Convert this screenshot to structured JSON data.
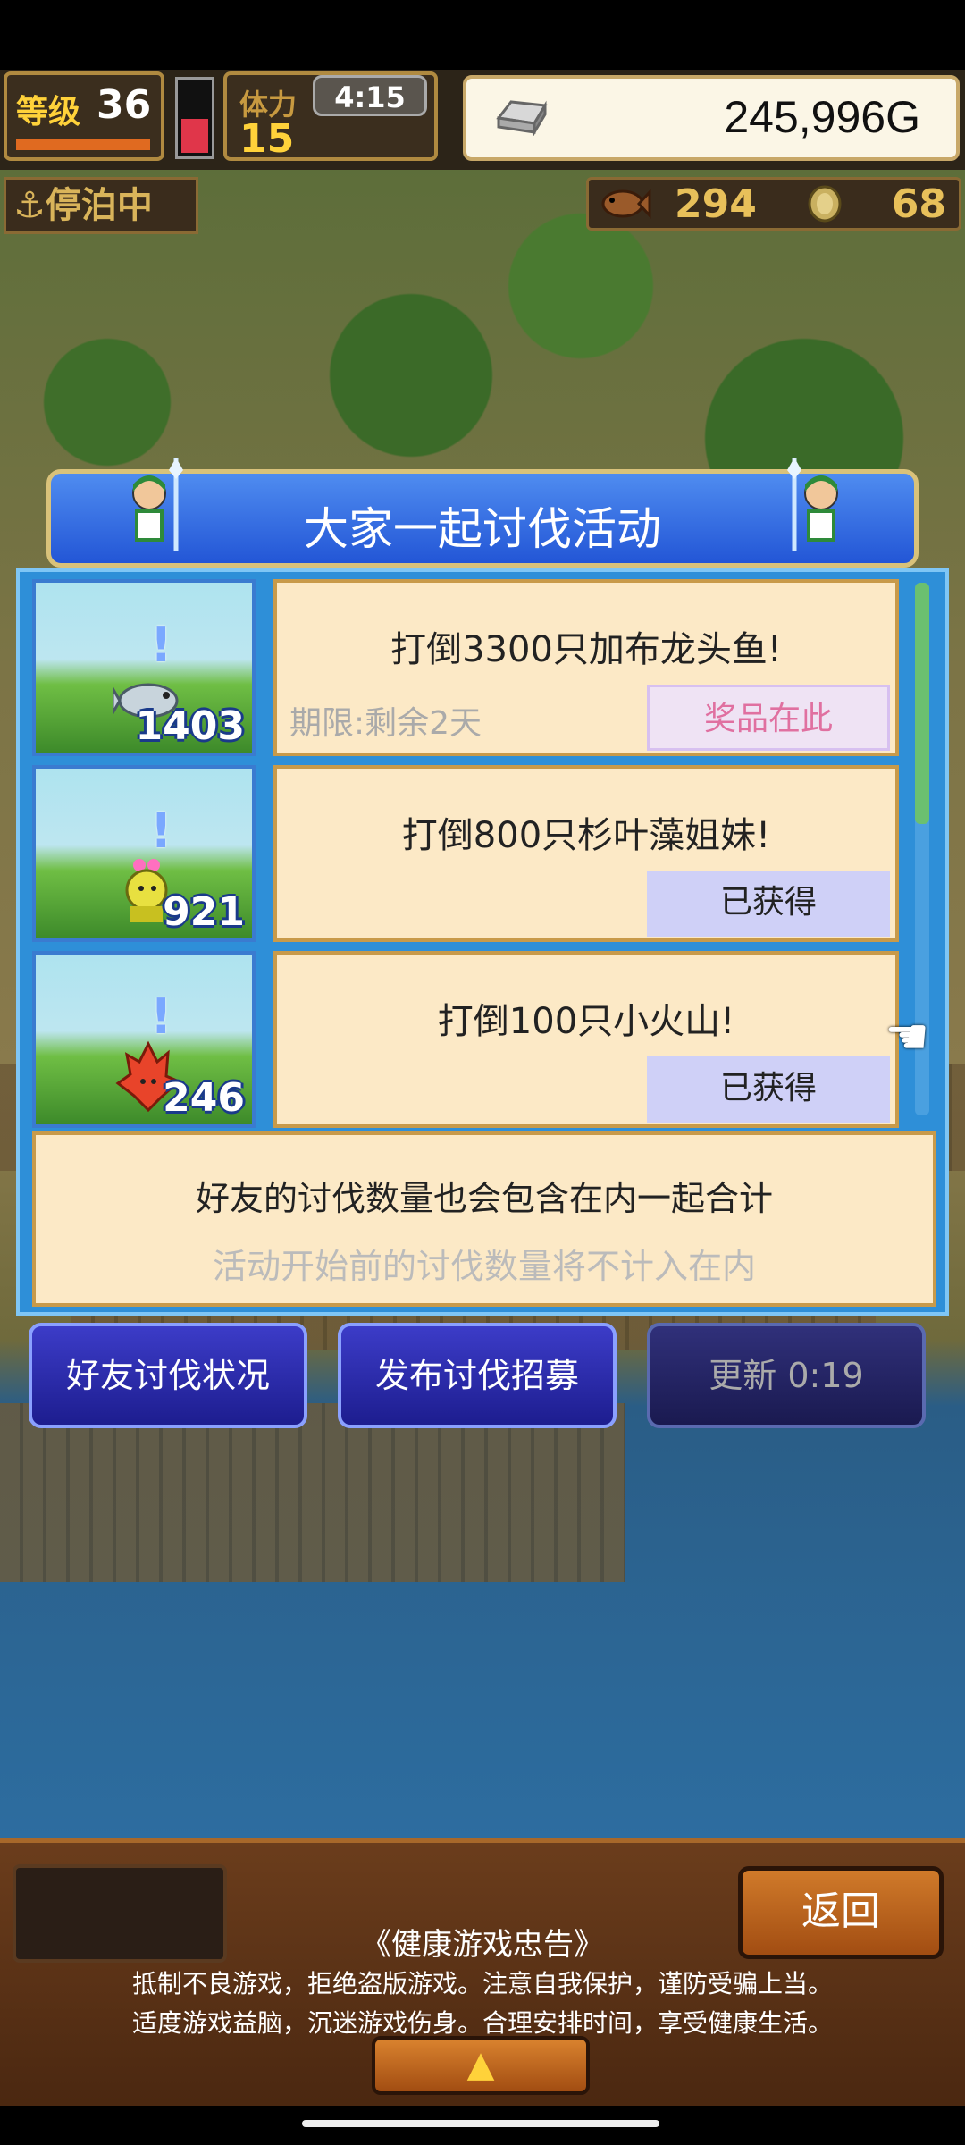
{
  "hud": {
    "level_label": "等级",
    "level": "36",
    "stamina_label": "体力",
    "stamina": "15",
    "clock": "4:15",
    "money": "245,996G",
    "status_label": "停泊中",
    "fish_count": "294",
    "coin_count": "68"
  },
  "panel": {
    "title": "大家一起讨伐活动",
    "events": [
      {
        "title": "打倒3300只加布龙头鱼!",
        "count": "1403",
        "deadline": "期限:剩余2天",
        "button": "奖品在此"
      },
      {
        "title": "打倒800只杉叶藻姐妹!",
        "count": "921",
        "button": "已获得"
      },
      {
        "title": "打倒100只小火山!",
        "count": "246",
        "button": "已获得"
      }
    ],
    "info_line1": "好友的讨伐数量也会包含在内一起合计",
    "info_line2": "活动开始前的讨伐数量将不计入在内"
  },
  "actions": {
    "friend_status": "好友讨伐状况",
    "post_recruit": "发布讨伐招募",
    "refresh": "更新 0:19"
  },
  "footer": {
    "back": "返回",
    "notice_title": "《健康游戏忠告》",
    "notice_line1": "抵制不良游戏，拒绝盗版游戏。注意自我保护，谨防受骗上当。",
    "notice_line2": "适度游戏益脑，沉迷游戏伤身。合理安排时间，享受健康生活。",
    "up_arrow": "▲"
  },
  "icons": {
    "pointer": "☚",
    "anchor": "⚓",
    "exclamation": "!"
  },
  "colors": {
    "panel_blue": "#2e8fd8",
    "card_bg": "#fce9c6",
    "action_blue": "#2c2cb0",
    "prize_pink": "#e070a0"
  }
}
